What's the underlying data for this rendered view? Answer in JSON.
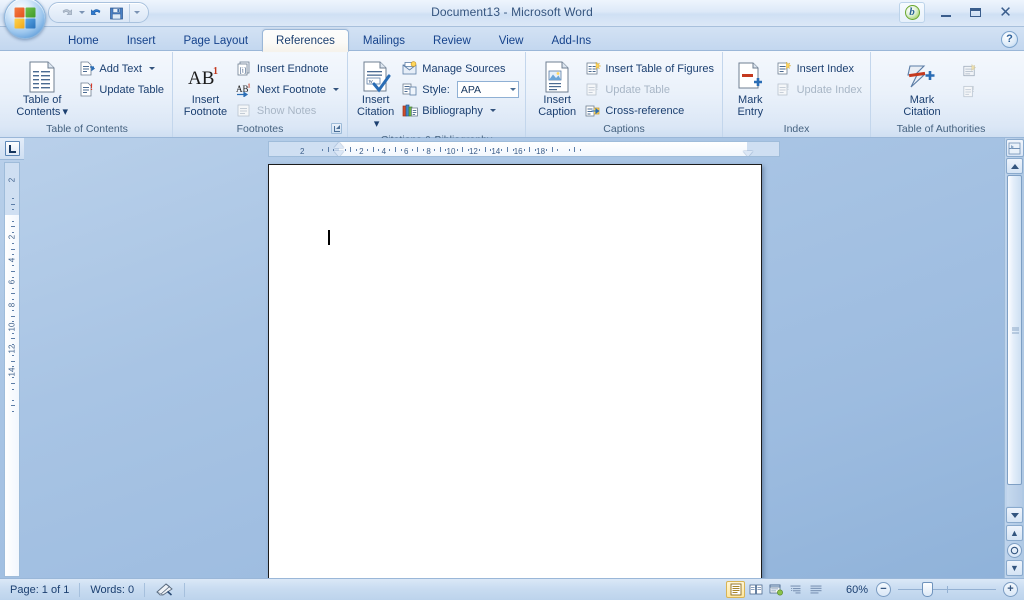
{
  "window": {
    "title": "Document13 - Microsoft Word",
    "minimize_label": "Minimize",
    "restore_label": "Restore Down",
    "close_label": "Close",
    "blogger_label": "b"
  },
  "quick_access": {
    "undo_label": "Undo",
    "undo_dropdown_label": "Undo options",
    "redo_label": "Repeat",
    "save_label": "Save",
    "customize_label": "Customize Quick Access Toolbar"
  },
  "office_button": {
    "label": "Office Button"
  },
  "help": {
    "label": "?"
  },
  "tabs": [
    {
      "label": "Home",
      "active": false
    },
    {
      "label": "Insert",
      "active": false
    },
    {
      "label": "Page Layout",
      "active": false
    },
    {
      "label": "References",
      "active": true
    },
    {
      "label": "Mailings",
      "active": false
    },
    {
      "label": "Review",
      "active": false
    },
    {
      "label": "View",
      "active": false
    },
    {
      "label": "Add-Ins",
      "active": false
    }
  ],
  "ribbon": {
    "groups": [
      {
        "name": "Table of Contents",
        "label": "Table of Contents",
        "has_launcher": false,
        "big_button": {
          "label_line1": "Table of",
          "label_line2": "Contents",
          "has_dropdown": true,
          "icon": "table-of-contents-icon"
        },
        "small_buttons": [
          {
            "label": "Add Text",
            "has_dropdown": true,
            "disabled": false,
            "icon": "add-text-icon"
          },
          {
            "label": "Update Table",
            "has_dropdown": false,
            "disabled": false,
            "icon": "update-table-icon"
          }
        ]
      },
      {
        "name": "Footnotes",
        "label": "Footnotes",
        "has_launcher": true,
        "big_button": {
          "label_line1": "Insert",
          "label_line2": "Footnote",
          "has_dropdown": false,
          "icon": "insert-footnote-icon"
        },
        "small_buttons": [
          {
            "label": "Insert Endnote",
            "has_dropdown": false,
            "disabled": false,
            "icon": "insert-endnote-icon"
          },
          {
            "label": "Next Footnote",
            "has_dropdown": true,
            "disabled": false,
            "icon": "next-footnote-icon"
          },
          {
            "label": "Show Notes",
            "has_dropdown": false,
            "disabled": true,
            "icon": "show-notes-icon"
          }
        ]
      },
      {
        "name": "Citations & Bibliography",
        "label": "Citations & Bibliography",
        "has_launcher": false,
        "big_button": {
          "label_line1": "Insert",
          "label_line2": "Citation",
          "has_dropdown": true,
          "icon": "insert-citation-icon"
        },
        "small_buttons": [
          {
            "label": "Manage Sources",
            "has_dropdown": false,
            "disabled": false,
            "icon": "manage-sources-icon"
          },
          {
            "label": "Style:",
            "has_dropdown": false,
            "disabled": false,
            "icon": "style-icon",
            "combo_value": "APA"
          },
          {
            "label": "Bibliography",
            "has_dropdown": true,
            "disabled": false,
            "icon": "bibliography-icon"
          }
        ]
      },
      {
        "name": "Captions",
        "label": "Captions",
        "has_launcher": false,
        "big_button": {
          "label_line1": "Insert",
          "label_line2": "Caption",
          "has_dropdown": false,
          "icon": "insert-caption-icon"
        },
        "small_buttons": [
          {
            "label": "Insert Table of Figures",
            "has_dropdown": false,
            "disabled": false,
            "icon": "insert-table-of-figures-icon"
          },
          {
            "label": "Update Table",
            "has_dropdown": false,
            "disabled": true,
            "icon": "update-table-icon"
          },
          {
            "label": "Cross-reference",
            "has_dropdown": false,
            "disabled": false,
            "icon": "cross-reference-icon"
          }
        ]
      },
      {
        "name": "Index",
        "label": "Index",
        "has_launcher": false,
        "big_button": {
          "label_line1": "Mark",
          "label_line2": "Entry",
          "has_dropdown": false,
          "icon": "mark-entry-icon"
        },
        "small_buttons": [
          {
            "label": "Insert Index",
            "has_dropdown": false,
            "disabled": false,
            "icon": "insert-index-icon"
          },
          {
            "label": "Update Index",
            "has_dropdown": false,
            "disabled": true,
            "icon": "update-index-icon"
          }
        ]
      },
      {
        "name": "Table of Authorities",
        "label": "Table of Authorities",
        "has_launcher": false,
        "big_button": {
          "label_line1": "Mark",
          "label_line2": "Citation",
          "has_dropdown": false,
          "icon": "mark-citation-icon"
        },
        "small_buttons": [
          {
            "label": "",
            "has_dropdown": false,
            "disabled": true,
            "icon": "insert-table-of-authorities-icon"
          },
          {
            "label": "",
            "has_dropdown": false,
            "disabled": true,
            "icon": "update-table-icon"
          }
        ]
      }
    ]
  },
  "ruler": {
    "tab_selector_label": "Left Tab",
    "horizontal_ticks": [
      "2",
      "2",
      "4",
      "6",
      "8",
      "10",
      "12",
      "14",
      "16",
      "18"
    ],
    "vertical_ticks": [
      "2",
      "2",
      "4",
      "6",
      "8",
      "10",
      "12",
      "14"
    ]
  },
  "document": {
    "page_count": 1,
    "content": ""
  },
  "scrollbar": {
    "up_label": "Line up",
    "down_label": "Line down",
    "previous_label": "Previous Page",
    "select_browse_label": "Select Browse Object",
    "next_label": "Next Page",
    "split_label": "Split window"
  },
  "statusbar": {
    "page_text": "Page: 1 of 1",
    "words_text": "Words: 0",
    "proofing_label": "Proofing errors",
    "zoom_text": "60%",
    "zoom_out_label": "−",
    "zoom_in_label": "+",
    "views": [
      {
        "name": "print-layout",
        "label": "Print Layout",
        "active": true
      },
      {
        "name": "full-screen-reading",
        "label": "Full Screen Reading",
        "active": false
      },
      {
        "name": "web-layout",
        "label": "Web Layout",
        "active": false
      },
      {
        "name": "outline",
        "label": "Outline",
        "active": false
      },
      {
        "name": "draft",
        "label": "Draft",
        "active": false
      }
    ]
  },
  "colors": {
    "accent": "#15428b",
    "ribbon_bg": "#eaf1fa",
    "workspace_bg": "#a8c4e4",
    "page_bg": "#ffffff"
  }
}
